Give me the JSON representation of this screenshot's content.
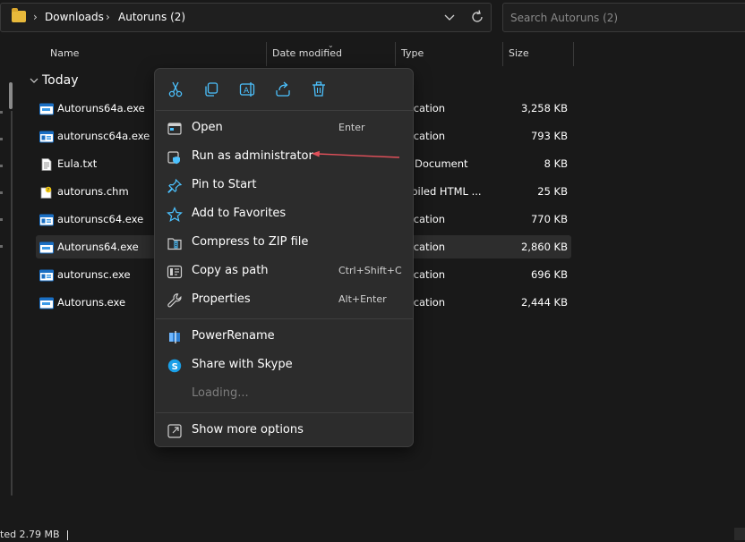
{
  "address_bar": {
    "crumbs": [
      "Downloads",
      "Autoruns (2)"
    ],
    "separator": "›"
  },
  "search": {
    "placeholder": "Search Autoruns (2)"
  },
  "columns": {
    "name": "Name",
    "date_modified": "Date modified",
    "type": "Type",
    "size": "Size"
  },
  "group": {
    "label": "Today"
  },
  "files": [
    {
      "name": "Autoruns64a.exe",
      "type": "plication",
      "size": "3,258 KB",
      "icon": "exe-window-icon"
    },
    {
      "name": "autorunsc64a.exe",
      "type": "plication",
      "size": "793 KB",
      "icon": "exe-console-icon"
    },
    {
      "name": "Eula.txt",
      "type": "xt Document",
      "size": "8 KB",
      "icon": "text-file-icon"
    },
    {
      "name": "autoruns.chm",
      "type": "mpiled HTML ...",
      "size": "25 KB",
      "icon": "help-file-icon"
    },
    {
      "name": "autorunsc64.exe",
      "type": "plication",
      "size": "770 KB",
      "icon": "exe-console-icon"
    },
    {
      "name": "Autoruns64.exe",
      "type": "plication",
      "size": "2,860 KB",
      "icon": "exe-window-icon"
    },
    {
      "name": "autorunsc.exe",
      "type": "plication",
      "size": "696 KB",
      "icon": "exe-console-icon"
    },
    {
      "name": "Autoruns.exe",
      "type": "plication",
      "size": "2,444 KB",
      "icon": "exe-window-icon"
    }
  ],
  "selected_file_index": 5,
  "context_menu": {
    "toolbar": [
      "cut-icon",
      "copy-icon",
      "rename-icon",
      "share-icon",
      "delete-icon"
    ],
    "items": [
      {
        "label": "Open",
        "shortcut": "Enter",
        "icon": "open-icon"
      },
      {
        "label": "Run as administrator",
        "shortcut": "",
        "icon": "shield-icon"
      },
      {
        "label": "Pin to Start",
        "shortcut": "",
        "icon": "pin-icon"
      },
      {
        "label": "Add to Favorites",
        "shortcut": "",
        "icon": "star-icon"
      },
      {
        "label": "Compress to ZIP file",
        "shortcut": "",
        "icon": "zip-icon"
      },
      {
        "label": "Copy as path",
        "shortcut": "Ctrl+Shift+C",
        "icon": "copy-path-icon"
      },
      {
        "label": "Properties",
        "shortcut": "Alt+Enter",
        "icon": "wrench-icon"
      }
    ],
    "extra_items": [
      {
        "label": "PowerRename",
        "icon": "powerrename-icon"
      },
      {
        "label": "Share with Skype",
        "icon": "skype-icon"
      },
      {
        "label": "Loading...",
        "icon": ""
      }
    ],
    "more": {
      "label": "Show more options",
      "icon": "show-more-icon"
    }
  },
  "status_bar": {
    "text": "ted  2.79 MB"
  },
  "colors": {
    "background": "#191919",
    "menu_background": "#2c2c2c",
    "accent_blue": "#4cc2ff",
    "annotation_red": "#e0505a",
    "folder_yellow": "#e8b93b"
  }
}
